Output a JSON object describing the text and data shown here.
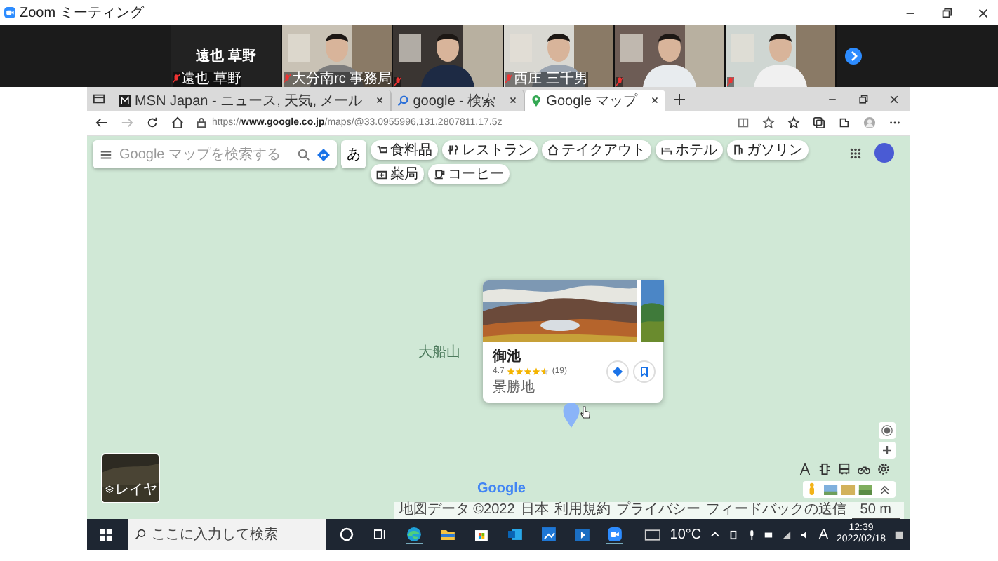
{
  "window": {
    "title": "Zoom ミーティング"
  },
  "participants": [
    {
      "kind": "name",
      "name": "遠也 草野",
      "label": "遠也 草野"
    },
    {
      "kind": "video",
      "label": "大分南rc 事務局"
    },
    {
      "kind": "video"
    },
    {
      "kind": "video",
      "label": "西庄 三千男"
    },
    {
      "kind": "video"
    },
    {
      "kind": "video"
    }
  ],
  "browser": {
    "tabs": [
      {
        "title": "MSN Japan - ニュース, 天気, メール",
        "selected": false
      },
      {
        "title": "google - 検索",
        "selected": false
      },
      {
        "title": "Google マップ",
        "selected": true
      }
    ],
    "url": "https://**www.google.co.jp**/maps/@33.0955996,131.2807811,17.5z"
  },
  "map": {
    "search": {
      "placeholder": "Google マップを検索する"
    },
    "ime": "あ",
    "chips": [
      {
        "label": "食料品"
      },
      {
        "label": "レストラン"
      },
      {
        "label": "テイクアウト"
      },
      {
        "label": "ホテル"
      },
      {
        "label": "ガソリン"
      },
      {
        "label": "薬局"
      },
      {
        "label": "コーヒー"
      }
    ],
    "labels": [
      "大船山"
    ],
    "place": {
      "name": "御池",
      "rating": "4.7",
      "stars": 4.5,
      "count": "(19)",
      "category": "景勝地"
    },
    "layer": "レイヤ",
    "logo": "Google",
    "attribution": [
      "地図データ ©2022",
      "日本",
      "利用規約",
      "プライバシー",
      "フィードバックの送信",
      "50 m"
    ]
  },
  "taskbar": {
    "search": {
      "placeholder": "ここに入力して検索"
    },
    "weather": "10°C",
    "ime": "A",
    "time": "12:39",
    "date": "2022/02/18"
  }
}
